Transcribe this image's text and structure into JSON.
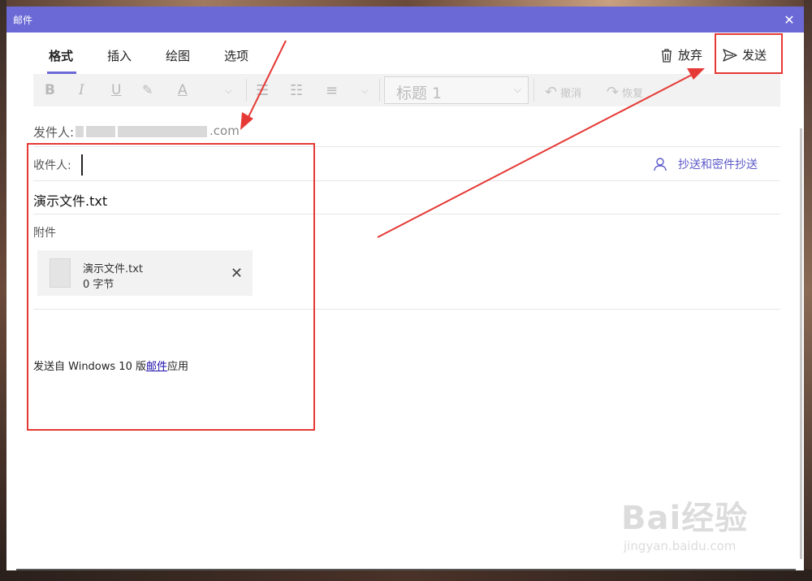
{
  "window": {
    "title": "邮件",
    "close_icon": "close-icon"
  },
  "tabs": [
    "格式",
    "插入",
    "绘图",
    "选项"
  ],
  "actions": {
    "discard_label": "放弃",
    "send_label": "发送"
  },
  "toolbar": {
    "bold": "B",
    "italic": "I",
    "underline": "U",
    "font_color": "A",
    "style_value": "标题 1",
    "undo_label": "撤消",
    "redo_label": "恢复"
  },
  "compose": {
    "from_label": "发件人:",
    "from_suffix": ".com",
    "to_label": "收件人:",
    "to_value": "",
    "cc_bcc_label": "抄送和密件抄送",
    "subject": "演示文件.txt",
    "attachments_label": "附件",
    "attachment": {
      "name": "演示文件.txt",
      "size": "0 字节"
    },
    "signature_prefix": "发送自 Windows 10 版",
    "signature_link": "邮件",
    "signature_suffix": "应用"
  },
  "watermark": {
    "brand": "Bai经验",
    "url": "jingyan.baidu.com"
  },
  "colors": {
    "accent": "#6b69d6",
    "annotation": "#e53935",
    "link": "#1a0dab"
  }
}
